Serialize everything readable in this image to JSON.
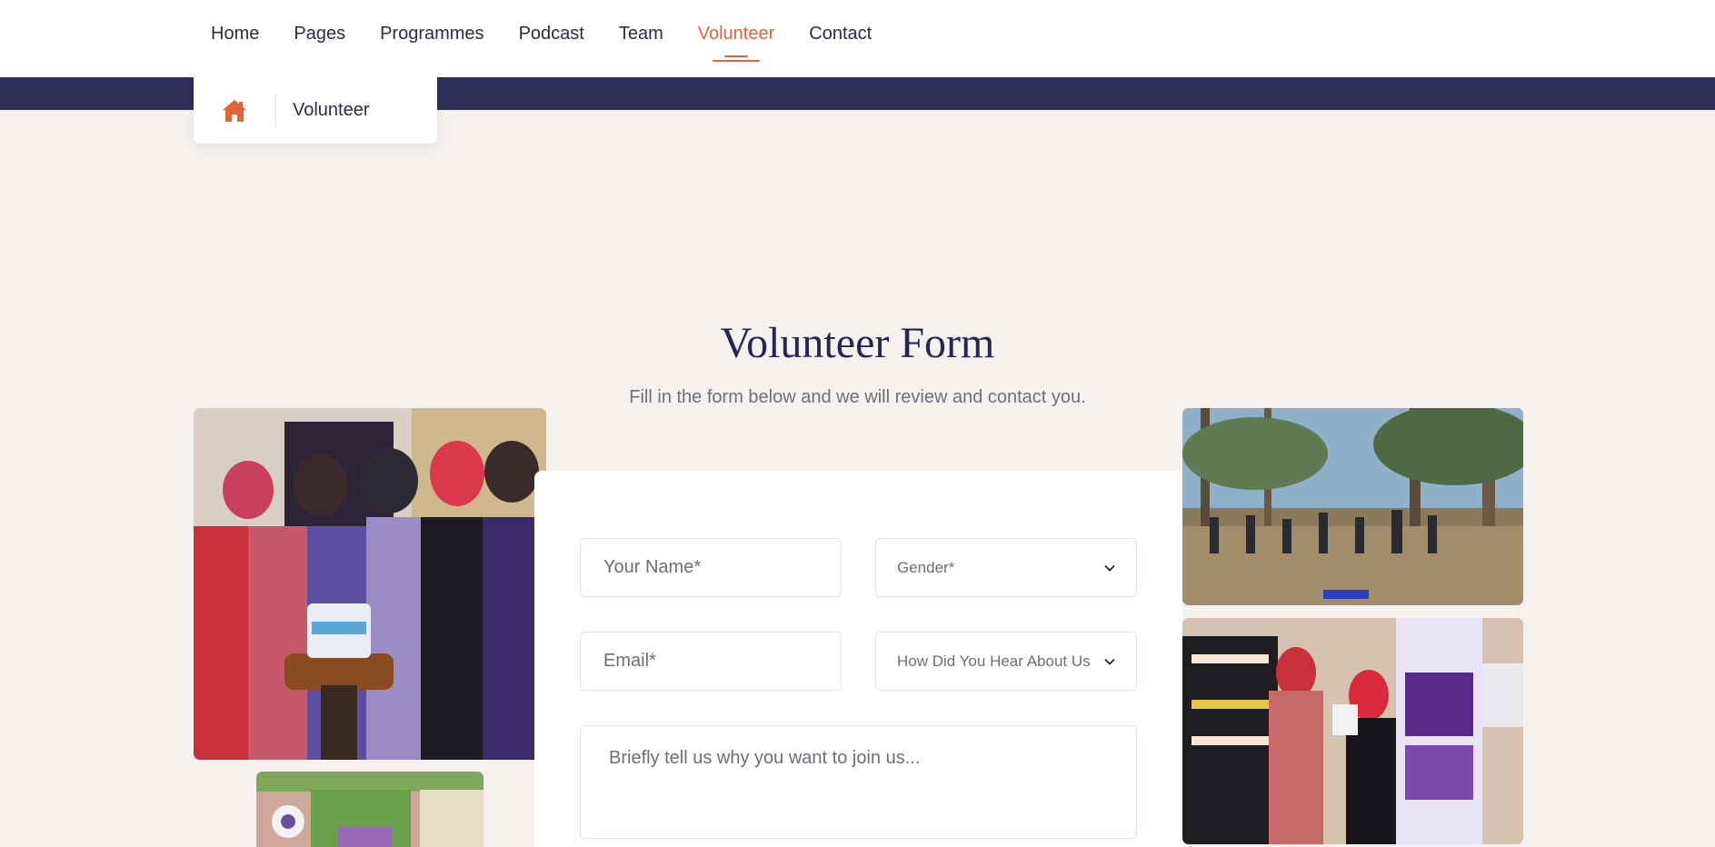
{
  "nav": {
    "items": [
      {
        "label": "Home",
        "active": false
      },
      {
        "label": "Pages",
        "active": false
      },
      {
        "label": "Programmes",
        "active": false
      },
      {
        "label": "Podcast",
        "active": false
      },
      {
        "label": "Team",
        "active": false
      },
      {
        "label": "Volunteer",
        "active": true
      },
      {
        "label": "Contact",
        "active": false
      }
    ]
  },
  "breadcrumb": {
    "home_icon": "home-icon",
    "current": "Volunteer"
  },
  "form": {
    "title": "Volunteer Form",
    "subtitle": "Fill in the form below and we will review and contact you.",
    "name_placeholder": "Your Name*",
    "gender_selected": "Gender*",
    "email_placeholder": "Email*",
    "hear_selected": "How Did You Hear About Us",
    "reason_placeholder": "Briefly tell us why you want to join us..."
  },
  "colors": {
    "accent": "#e0663a",
    "band": "#312d5a",
    "page_bg": "#f4f1ef",
    "heading": "#262650"
  }
}
